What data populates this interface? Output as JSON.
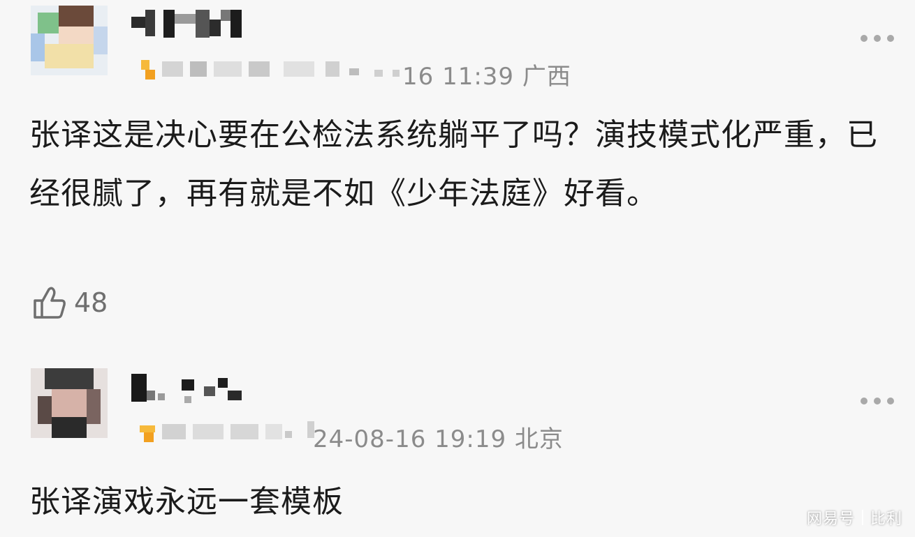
{
  "comments": [
    {
      "timestamp_region": "16 11:39 广西",
      "body": "张译这是决心要在公检法系统躺平了吗？演技模式化严重，已经很腻了，再有就是不如《少年法庭》好看。",
      "likes": "48"
    },
    {
      "timestamp_region": "24-08-16 19:19 北京",
      "body": "张译演戏永远一套模板"
    }
  ],
  "watermark": {
    "platform": "网易号",
    "author": "比利"
  },
  "icons": {
    "more": "more-dots-icon",
    "like": "thumbs-up-icon",
    "badge": "level-badge-icon"
  },
  "colors": {
    "background": "#f7f7f7",
    "text": "#1b1b1b",
    "meta": "#8b8b8b",
    "badge": "#f2a020"
  }
}
